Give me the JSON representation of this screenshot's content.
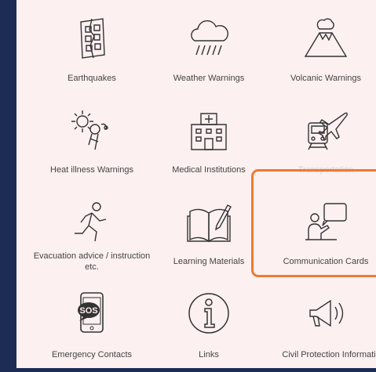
{
  "menu": {
    "items": [
      {
        "label": "Earthquakes",
        "icon": "earthquake-building-icon"
      },
      {
        "label": "Weather Warnings",
        "icon": "rain-cloud-icon"
      },
      {
        "label": "Volcanic Warnings",
        "icon": "volcano-icon"
      },
      {
        "label": "Heat illness Warnings",
        "icon": "heat-illness-icon"
      },
      {
        "label": "Medical Institutions",
        "icon": "hospital-icon"
      },
      {
        "label": "Transportation",
        "icon": "train-plane-icon"
      },
      {
        "label": "Evacuation advice / instruction etc.",
        "icon": "running-person-icon"
      },
      {
        "label": "Learning Materials",
        "icon": "open-book-icon"
      },
      {
        "label": "Communication Cards",
        "icon": "speech-card-icon"
      },
      {
        "label": "Emergency Contacts",
        "icon": "sos-phone-icon"
      },
      {
        "label": "Links",
        "icon": "info-icon"
      },
      {
        "label": "Civil Protection Informati",
        "icon": "megaphone-icon"
      }
    ]
  },
  "colors": {
    "background": "#1d2c55",
    "panel": "#fcf0f1",
    "highlight": "#ee7a2e",
    "icon_stroke": "#333333"
  }
}
